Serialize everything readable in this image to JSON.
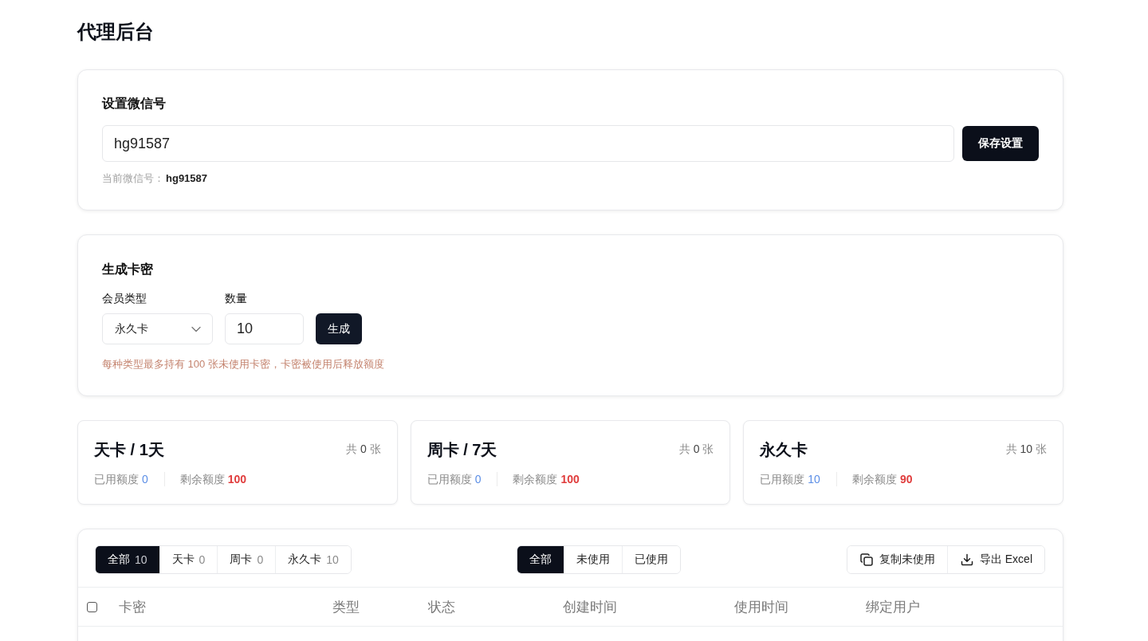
{
  "page": {
    "title": "代理后台"
  },
  "wechat_card": {
    "title": "设置微信号",
    "input": {
      "value": "hg91587"
    },
    "button": "保存设置",
    "current": {
      "label": "当前微信号：",
      "value": "hg91587"
    }
  },
  "generate_card": {
    "title": "生成卡密",
    "fields": [
      {
        "kind": "select",
        "label": "会员类型",
        "value": "永久卡"
      },
      {
        "kind": "input",
        "label": "数量",
        "value": "10"
      }
    ],
    "button": "生成",
    "note": "每种类型最多持有 100 张未使用卡密，卡密被使用后释放额度"
  },
  "stats": [
    {
      "title": "天卡 / 1天",
      "total": {
        "prefix": "共",
        "count": "0",
        "unit": "张"
      },
      "used": {
        "label": "已用额度",
        "value": "0"
      },
      "remaining": {
        "label": "剩余额度",
        "value": "100"
      }
    },
    {
      "title": "周卡 / 7天",
      "total": {
        "prefix": "共",
        "count": "0",
        "unit": "张"
      },
      "used": {
        "label": "已用额度",
        "value": "0"
      },
      "remaining": {
        "label": "剩余额度",
        "value": "100"
      }
    },
    {
      "title": "永久卡",
      "total": {
        "prefix": "共",
        "count": "10",
        "unit": "张"
      },
      "used": {
        "label": "已用额度",
        "value": "10"
      },
      "remaining": {
        "label": "剩余额度",
        "value": "90"
      }
    }
  ],
  "table": {
    "type_filters": [
      {
        "label": "全部",
        "count": "10",
        "selected": true
      },
      {
        "label": "天卡",
        "count": "0",
        "selected": false
      },
      {
        "label": "周卡",
        "count": "0",
        "selected": false
      },
      {
        "label": "永久卡",
        "count": "10",
        "selected": false
      }
    ],
    "status_filters": [
      {
        "label": "全部",
        "selected": true
      },
      {
        "label": "未使用",
        "selected": false
      },
      {
        "label": "已使用",
        "selected": false
      }
    ],
    "actions": [
      {
        "kind": "copy",
        "label": "复制未使用"
      },
      {
        "kind": "export",
        "label": "导出 Excel"
      }
    ],
    "select_all": {
      "checked": false
    },
    "columns": [
      "卡密",
      "类型",
      "状态",
      "创建时间",
      "使用时间",
      "绑定用户"
    ]
  }
}
